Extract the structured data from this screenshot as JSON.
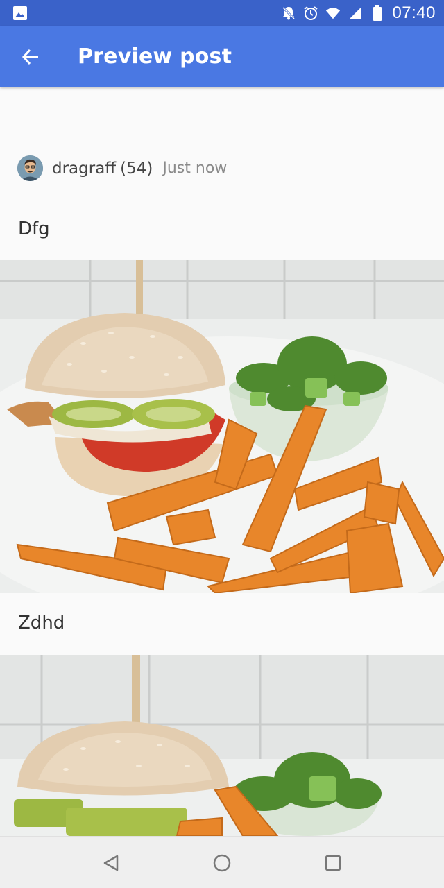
{
  "status_bar": {
    "time": "07:40",
    "icons": [
      "image-notification-icon",
      "notifications-off-icon",
      "alarm-icon",
      "wifi-icon",
      "cell-signal-icon",
      "battery-icon"
    ]
  },
  "app_bar": {
    "title": "Preview post",
    "back_icon": "arrow-back-icon",
    "color": "#4a78e3",
    "status_color": "#3a62c9"
  },
  "post": {
    "author": {
      "name": "dragraff",
      "reputation": "(54)",
      "time": "Just now",
      "avatar_icon": "avatar-icon"
    },
    "blocks": [
      {
        "type": "text",
        "text": "Dfg"
      },
      {
        "type": "image",
        "description_icon": "burger-photo"
      },
      {
        "type": "text",
        "text": "Zdhd"
      },
      {
        "type": "image",
        "description_icon": "burger-photo"
      }
    ]
  },
  "nav_bar": {
    "icons": [
      "back-triangle-icon",
      "home-circle-icon",
      "recents-square-icon"
    ]
  }
}
